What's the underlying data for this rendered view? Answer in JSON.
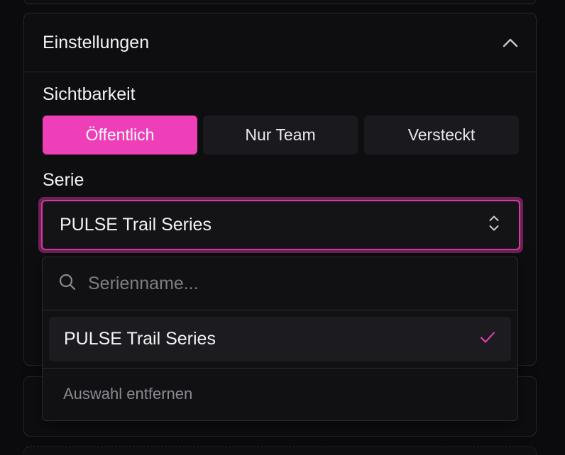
{
  "settings": {
    "title": "Einstellungen",
    "visibility": {
      "label": "Sichtbarkeit",
      "options": [
        "Öffentlich",
        "Nur Team",
        "Versteckt"
      ],
      "selected": "Öffentlich"
    },
    "series": {
      "label": "Serie",
      "value": "PULSE Trail Series"
    }
  },
  "dropdown": {
    "search_placeholder": "Serienname...",
    "options": [
      {
        "label": "PULSE Trail Series",
        "selected": true
      }
    ],
    "clear_label": "Auswahl entfernen"
  },
  "colors": {
    "accent": "#ee3fb8",
    "focus_ring": "#d43aa3",
    "background": "#0b0b0d",
    "card": "#0e0e11"
  },
  "icons": {
    "collapse": "chevron-up-icon",
    "select": "chevron-up-down-icon",
    "search": "search-icon",
    "check": "check-icon"
  }
}
